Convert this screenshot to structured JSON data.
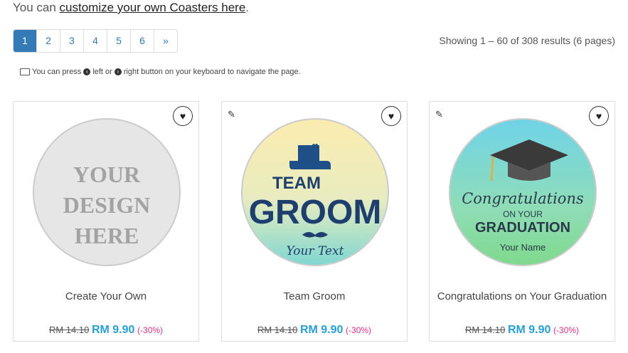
{
  "intro": {
    "text": "You can ",
    "link": "customize your own Coasters here",
    "suffix": "."
  },
  "pagination": {
    "pages": [
      "1",
      "2",
      "3",
      "4",
      "5",
      "6",
      "»"
    ],
    "active": "1"
  },
  "results": "Showing 1 – 60 of 308 results (6 pages)",
  "hint": {
    "part1": "You can press",
    "left": "left or",
    "right": "right button on your keyboard to navigate the page."
  },
  "products": [
    {
      "name": "Create Your Own",
      "old_price": "RM 14.10",
      "price": "RM 9.90",
      "discount": "(-30%)",
      "design": [
        "YOUR",
        "DESIGN",
        "HERE"
      ]
    },
    {
      "name": "Team Groom",
      "old_price": "RM 14.10",
      "price": "RM 9.90",
      "discount": "(-30%)",
      "design": [
        "TEAM",
        "GROOM",
        "Your Text"
      ]
    },
    {
      "name": "Congratulations on Your Graduation",
      "old_price": "RM 14.10",
      "price": "RM 9.90",
      "discount": "(-30%)",
      "design": [
        "Congratulations",
        "ON YOUR",
        "GRADUATION",
        "Your Name"
      ]
    }
  ]
}
